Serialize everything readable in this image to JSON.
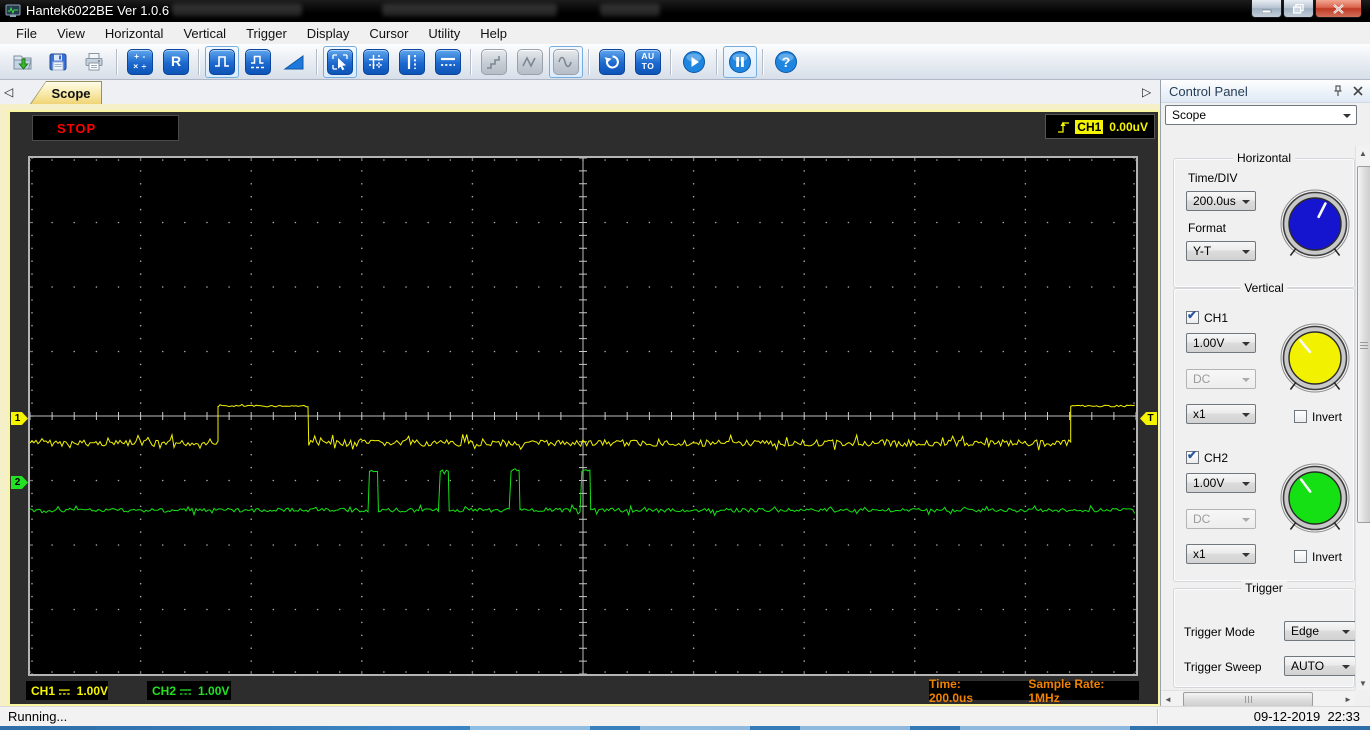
{
  "window": {
    "title": "Hantek6022BE Ver 1.0.6"
  },
  "menu_items": [
    "File",
    "View",
    "Horizontal",
    "Vertical",
    "Trigger",
    "Display",
    "Cursor",
    "Utility",
    "Help"
  ],
  "toolbar": [
    {
      "name": "open-button",
      "icon": "open",
      "kind": "plain"
    },
    {
      "name": "save-button",
      "icon": "save",
      "kind": "plain"
    },
    {
      "name": "print-button",
      "icon": "print",
      "kind": "plain"
    },
    {
      "name": "math-button",
      "kind": "badge",
      "lines": [
        "+ -",
        "× ÷"
      ],
      "sep": true
    },
    {
      "name": "reference-wave-button",
      "kind": "badge",
      "lines": [
        "R"
      ]
    },
    {
      "name": "square-wave-button",
      "icon": "pulse",
      "kind": "badge",
      "sep": true,
      "active": true
    },
    {
      "name": "pulse-measure-button",
      "icon": "pulse2",
      "kind": "badge"
    },
    {
      "name": "ramp-button",
      "icon": "ramp",
      "kind": "plain"
    },
    {
      "name": "cursor-select-button",
      "icon": "cursor",
      "kind": "badge",
      "sep": true,
      "active": true
    },
    {
      "name": "cross-cursor-button",
      "icon": "grid",
      "kind": "badge"
    },
    {
      "name": "vertical-cursor-button",
      "icon": "vbars",
      "kind": "badge"
    },
    {
      "name": "horizontal-cursor-button",
      "icon": "hdash",
      "kind": "badge"
    },
    {
      "name": "step-wave-button",
      "icon": "step",
      "kind": "badge",
      "sep": true,
      "disabled": true
    },
    {
      "name": "triangle-wave-button",
      "icon": "tri",
      "kind": "badge",
      "disabled": true
    },
    {
      "name": "sine-wave-button",
      "icon": "sine",
      "kind": "badge",
      "disabled": true,
      "active": true
    },
    {
      "name": "refresh-button",
      "icon": "refresh",
      "kind": "badge",
      "sep": true
    },
    {
      "name": "autoset-button",
      "kind": "badge",
      "lines": [
        "AU",
        "TO"
      ]
    },
    {
      "name": "start-button",
      "icon": "play",
      "kind": "circle",
      "sep": true
    },
    {
      "name": "pause-button",
      "icon": "pause",
      "kind": "circle",
      "sep": true,
      "active": true
    },
    {
      "name": "help-button",
      "icon": "help",
      "kind": "circle",
      "sep": true
    }
  ],
  "tab": {
    "label": "Scope"
  },
  "scope": {
    "run_status": "STOP",
    "trigger_readout": {
      "channel": "CH1",
      "value": "0.00uV"
    },
    "readouts": {
      "ch1_name": "CH1",
      "ch1_scale": "1.00V",
      "ch2_name": "CH2",
      "ch2_scale": "1.00V",
      "time": "Time: 200.0us",
      "sample_rate": "Sample Rate: 1MHz"
    },
    "markers": {
      "ch1": "1",
      "ch2": "2",
      "trigger": "T"
    },
    "colors": {
      "ch1": "#f2f200",
      "ch2": "#16e216",
      "readout_orange": "#f08200",
      "stop_red": "#ff0000"
    }
  },
  "chart_data": {
    "type": "line",
    "title": "Oscilloscope traces",
    "x_divisions": 10,
    "y_divisions": 8,
    "time_per_div": "200.0us",
    "sample_rate": "1MHz",
    "grid": "dots-with-center-crosshair",
    "series": [
      {
        "name": "CH1",
        "color": "#f2f200",
        "volts_per_div": "1.00V",
        "zero_marker_div": 0.0,
        "baseline_div": -0.42,
        "high_div": 0.155,
        "noise_div": 0.05,
        "high_segments_x_div": [
          [
            -3.3,
            -2.48
          ],
          [
            4.41,
            5.0
          ]
        ]
      },
      {
        "name": "CH2",
        "color": "#16e216",
        "volts_per_div": "1.00V",
        "zero_marker_div": -1.04,
        "baseline_div": -1.46,
        "high_div": -0.85,
        "noise_div": 0.03,
        "pulses_x_div": [
          [
            -1.93,
            -1.85
          ],
          [
            -1.29,
            -1.21
          ],
          [
            -0.65,
            -0.57
          ],
          [
            -0.01,
            0.07
          ]
        ]
      }
    ]
  },
  "control_panel": {
    "title": "Control Panel",
    "selector_value": "Scope",
    "horizontal": {
      "title": "Horizontal",
      "timediv_label": "Time/DIV",
      "timediv_value": "200.0us",
      "format_label": "Format",
      "format_value": "Y-T",
      "knob_color": "#1515d0",
      "knob_angle": 27
    },
    "vertical_title": "Vertical",
    "channels": [
      {
        "label": "CH1",
        "checked": true,
        "volts": "1.00V",
        "coupling": "DC",
        "probe": "x1",
        "invert_label": "Invert",
        "invert": false,
        "knob_color": "#f2f200",
        "knob_angle": -40
      },
      {
        "label": "CH2",
        "checked": true,
        "volts": "1.00V",
        "coupling": "DC",
        "probe": "x1",
        "invert_label": "Invert",
        "invert": false,
        "knob_color": "#14e014",
        "knob_angle": -37
      }
    ],
    "trigger": {
      "title": "Trigger",
      "mode_label": "Trigger Mode",
      "mode_value": "Edge",
      "sweep_label": "Trigger Sweep",
      "sweep_value": "AUTO"
    }
  },
  "status_bar": {
    "left": "Running...",
    "datetime": "09-12-2019  22:33"
  }
}
